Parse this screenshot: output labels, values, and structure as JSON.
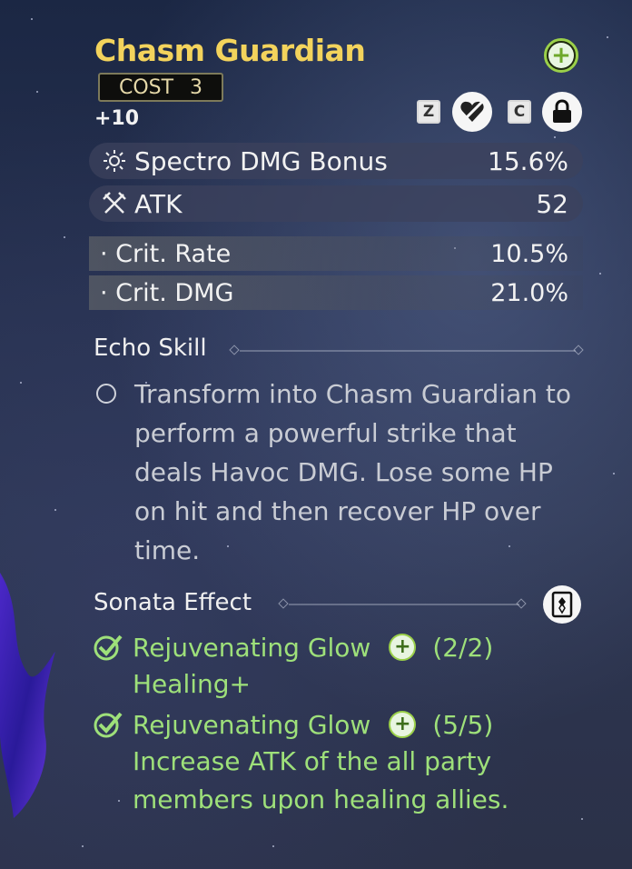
{
  "echo": {
    "name": "Chasm Guardian",
    "cost_label": "COST",
    "cost_value": "3",
    "level": "+10"
  },
  "controls": {
    "key_z": "Z",
    "key_c": "C"
  },
  "main_stats": [
    {
      "name": "Spectro DMG Bonus",
      "value": "15.6%",
      "icon": "spectro-icon"
    },
    {
      "name": "ATK",
      "value": "52",
      "icon": "crossed-swords-icon"
    }
  ],
  "sub_stats": [
    {
      "name": "· Crit. Rate",
      "value": "10.5%"
    },
    {
      "name": "· Crit. DMG",
      "value": "21.0%"
    }
  ],
  "echo_skill": {
    "heading": "Echo Skill",
    "description": "Transform into Chasm Guardian to perform a powerful strike that deals Havoc DMG. Lose some HP on hit and then recover HP over time."
  },
  "sonata": {
    "heading": "Sonata Effect",
    "effects": [
      {
        "name": "Rejuvenating Glow",
        "count": "(2/2)",
        "description": "Healing+"
      },
      {
        "name": "Rejuvenating Glow",
        "count": "(5/5)",
        "description": "Increase ATK of the all party members upon healing allies."
      }
    ]
  },
  "colors": {
    "title": "#f3d35c",
    "effect_active": "#9ee07a",
    "accent_green": "#9bd04a"
  }
}
